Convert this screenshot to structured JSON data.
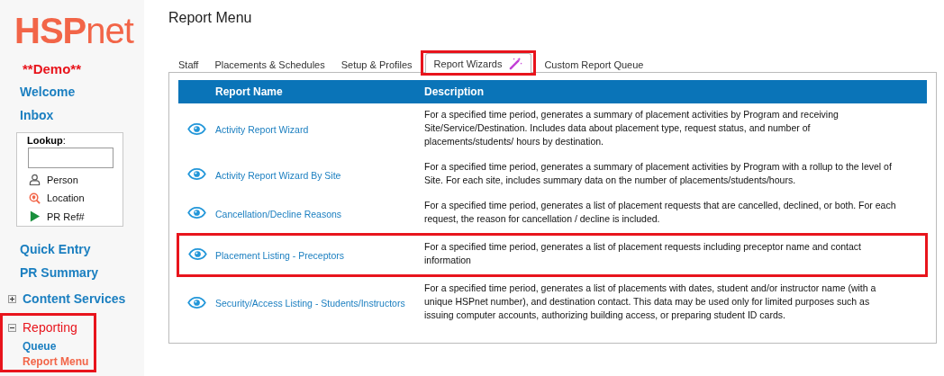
{
  "sidebar": {
    "logo": "**HSP**net",
    "demo_label": "**Demo**",
    "top_items": [
      {
        "label": "Welcome"
      },
      {
        "label": "Inbox"
      }
    ],
    "lookup": {
      "label": "**Lookup**:",
      "options": [
        {
          "kind": "person",
          "label": "Person"
        },
        {
          "kind": "location",
          "label": "Location"
        },
        {
          "kind": "pr",
          "label": "PR Ref#"
        }
      ]
    },
    "bottom_items": [
      {
        "kind": "link",
        "label": "Quick Entry"
      },
      {
        "kind": "link",
        "label": "PR Summary"
      },
      {
        "kind": "group",
        "label": "Content Services",
        "expanded": false,
        "highlighted": false
      },
      {
        "kind": "group",
        "label": "Reporting",
        "expanded": true,
        "highlighted": true,
        "children": [
          {
            "label": "Queue",
            "selected": false
          },
          {
            "label": "Report Menu",
            "selected": true
          }
        ]
      }
    ]
  },
  "page_title": "Report Menu",
  "tabs": [
    {
      "kind": "text",
      "label": "Staff",
      "selected": false,
      "highlighted": false
    },
    {
      "kind": "text",
      "label": "Placements & Schedules",
      "selected": false,
      "highlighted": false
    },
    {
      "kind": "text",
      "label": "Setup & Profiles",
      "selected": false,
      "highlighted": false
    },
    {
      "kind": "wizard",
      "label": "Report Wizards",
      "selected": true,
      "highlighted": true
    },
    {
      "kind": "text",
      "label": "Custom Report Queue",
      "selected": false,
      "highlighted": false
    }
  ],
  "table": {
    "columns": [
      "Report Name",
      "Description"
    ],
    "rows": [
      {
        "name": "Activity Report Wizard",
        "description": "For a specified time period, generates a summary of placement activities by Program and receiving Site/Service/Destination. Includes data about placement type, request status, and number of placements/students/ hours by destination.",
        "highlighted": false
      },
      {
        "name": "Activity Report Wizard By Site",
        "description": "For a specified time period, generates a summary of placement activities by Program with a rollup to the level of Site. For each site, includes summary data on the number of placements/students/hours.",
        "highlighted": false
      },
      {
        "name": "Cancellation/Decline Reasons",
        "description": "For a specified time period, generates a list of placement requests that are cancelled, declined, or both. For each request, the reason for cancellation / decline is included.",
        "highlighted": false
      },
      {
        "name": "Placement Listing - Preceptors",
        "description": "For a specified time period, generates a list of placement requests including preceptor name and contact information",
        "highlighted": true
      },
      {
        "name": "Security/Access Listing - Students/Instructors",
        "description": "For a specified time period, generates a list of placements with dates, student and/or instructor name (with a unique HSPnet number), and destination contact. This data may be used only for limited purposes such as issuing computer accounts, authorizing building access, or preparing student ID cards.",
        "highlighted": false
      }
    ]
  }
}
